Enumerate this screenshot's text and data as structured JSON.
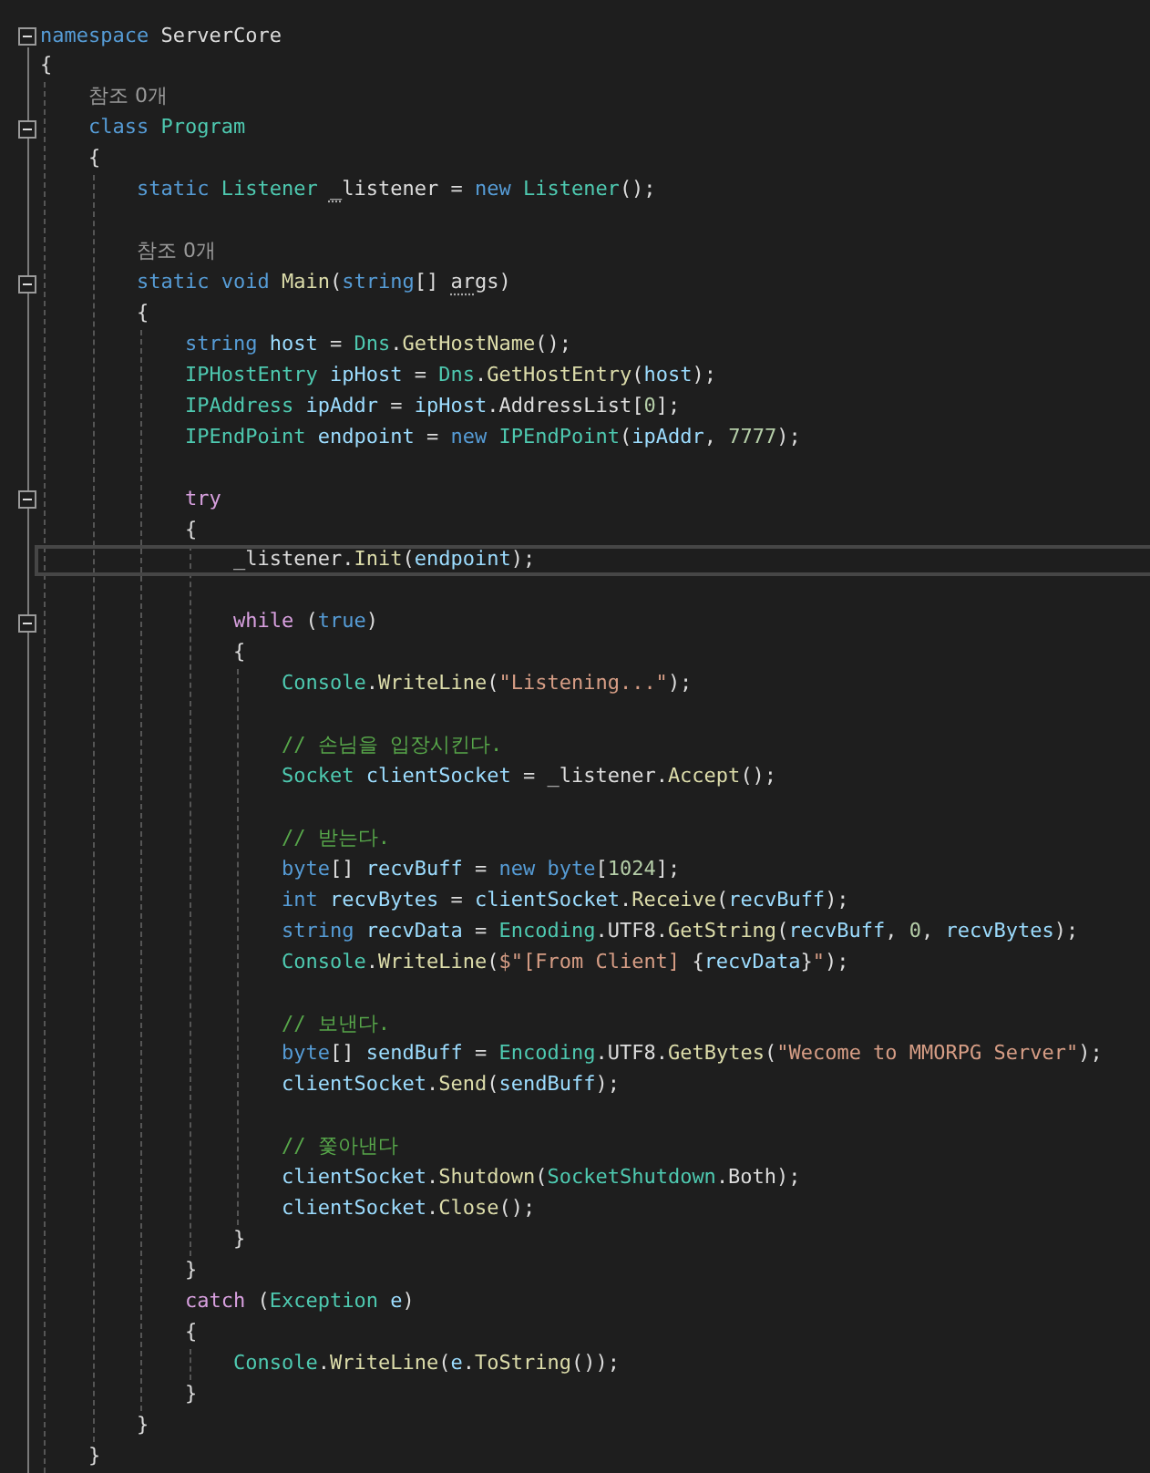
{
  "lines": [
    {
      "kind": "code",
      "fold": {
        "expanded": true
      },
      "tokens": [
        {
          "kind": "keyword",
          "text": "namespace "
        },
        {
          "kind": "plain",
          "text": "ServerCore"
        }
      ]
    },
    {
      "kind": "code",
      "tokens": [
        {
          "kind": "plain",
          "text": "{"
        }
      ],
      "children": [
        {
          "kind": "codelens",
          "text": "참조 0개"
        },
        {
          "kind": "code",
          "fold": {
            "expanded": true
          },
          "tokens": [
            {
              "kind": "keyword",
              "text": "class "
            },
            {
              "kind": "type",
              "text": "Program"
            }
          ]
        },
        {
          "kind": "code",
          "tokens": [
            {
              "kind": "plain",
              "text": "{"
            }
          ],
          "children": [
            {
              "kind": "code",
              "tokens": [
                {
                  "kind": "keyword",
                  "text": "static "
                },
                {
                  "kind": "type",
                  "text": "Listener "
                },
                {
                  "kind": "plain",
                  "text": "_",
                  "underlined": true
                },
                {
                  "kind": "plain",
                  "text": "listener = "
                },
                {
                  "kind": "keyword",
                  "text": "new "
                },
                {
                  "kind": "type",
                  "text": "Listener"
                },
                {
                  "kind": "plain",
                  "text": "();"
                }
              ]
            },
            {
              "kind": "blank"
            },
            {
              "kind": "codelens",
              "text": "참조 0개"
            },
            {
              "kind": "code",
              "fold": {
                "expanded": true
              },
              "tokens": [
                {
                  "kind": "keyword",
                  "text": "static "
                },
                {
                  "kind": "keyword",
                  "text": "void "
                },
                {
                  "kind": "method",
                  "text": "Main"
                },
                {
                  "kind": "plain",
                  "text": "("
                },
                {
                  "kind": "keyword",
                  "text": "string"
                },
                {
                  "kind": "plain",
                  "text": "[] "
                },
                {
                  "kind": "plain",
                  "text": "ar",
                  "underlined": true
                },
                {
                  "kind": "plain",
                  "text": "gs)"
                }
              ]
            },
            {
              "kind": "code",
              "tokens": [
                {
                  "kind": "plain",
                  "text": "{"
                }
              ],
              "children": [
                {
                  "kind": "code",
                  "tokens": [
                    {
                      "kind": "keyword",
                      "text": "string "
                    },
                    {
                      "kind": "variable",
                      "text": "host"
                    },
                    {
                      "kind": "plain",
                      "text": " = "
                    },
                    {
                      "kind": "type",
                      "text": "Dns"
                    },
                    {
                      "kind": "plain",
                      "text": "."
                    },
                    {
                      "kind": "method",
                      "text": "GetHostName"
                    },
                    {
                      "kind": "plain",
                      "text": "();"
                    }
                  ]
                },
                {
                  "kind": "code",
                  "tokens": [
                    {
                      "kind": "type",
                      "text": "IPHostEntry "
                    },
                    {
                      "kind": "variable",
                      "text": "ipHost"
                    },
                    {
                      "kind": "plain",
                      "text": " = "
                    },
                    {
                      "kind": "type",
                      "text": "Dns"
                    },
                    {
                      "kind": "plain",
                      "text": "."
                    },
                    {
                      "kind": "method",
                      "text": "GetHostEntry"
                    },
                    {
                      "kind": "plain",
                      "text": "("
                    },
                    {
                      "kind": "variable",
                      "text": "host"
                    },
                    {
                      "kind": "plain",
                      "text": ");"
                    }
                  ]
                },
                {
                  "kind": "code",
                  "tokens": [
                    {
                      "kind": "type",
                      "text": "IPAddress "
                    },
                    {
                      "kind": "variable",
                      "text": "ipAddr"
                    },
                    {
                      "kind": "plain",
                      "text": " = "
                    },
                    {
                      "kind": "variable",
                      "text": "ipHost"
                    },
                    {
                      "kind": "plain",
                      "text": ".AddressList["
                    },
                    {
                      "kind": "number",
                      "text": "0"
                    },
                    {
                      "kind": "plain",
                      "text": "];"
                    }
                  ]
                },
                {
                  "kind": "code",
                  "tokens": [
                    {
                      "kind": "type",
                      "text": "IPEndPoint "
                    },
                    {
                      "kind": "variable",
                      "text": "endpoint"
                    },
                    {
                      "kind": "plain",
                      "text": " = "
                    },
                    {
                      "kind": "keyword",
                      "text": "new "
                    },
                    {
                      "kind": "type",
                      "text": "IPEndPoint"
                    },
                    {
                      "kind": "plain",
                      "text": "("
                    },
                    {
                      "kind": "variable",
                      "text": "ipAddr"
                    },
                    {
                      "kind": "plain",
                      "text": ", "
                    },
                    {
                      "kind": "number",
                      "text": "7777"
                    },
                    {
                      "kind": "plain",
                      "text": ");"
                    }
                  ]
                },
                {
                  "kind": "blank"
                },
                {
                  "kind": "code",
                  "fold": {
                    "expanded": true
                  },
                  "tokens": [
                    {
                      "kind": "control",
                      "text": "try"
                    }
                  ]
                },
                {
                  "kind": "code",
                  "tokens": [
                    {
                      "kind": "plain",
                      "text": "{"
                    }
                  ],
                  "children": [
                    {
                      "kind": "code",
                      "current": true,
                      "tokens": [
                        {
                          "kind": "plain",
                          "text": "_listener."
                        },
                        {
                          "kind": "method",
                          "text": "Init"
                        },
                        {
                          "kind": "plain",
                          "text": "("
                        },
                        {
                          "kind": "variable",
                          "text": "endpoint"
                        },
                        {
                          "kind": "plain",
                          "text": ");"
                        }
                      ]
                    },
                    {
                      "kind": "blank"
                    },
                    {
                      "kind": "code",
                      "fold": {
                        "expanded": true
                      },
                      "tokens": [
                        {
                          "kind": "control",
                          "text": "while"
                        },
                        {
                          "kind": "plain",
                          "text": " ("
                        },
                        {
                          "kind": "keyword",
                          "text": "true"
                        },
                        {
                          "kind": "plain",
                          "text": ")"
                        }
                      ]
                    },
                    {
                      "kind": "code",
                      "tokens": [
                        {
                          "kind": "plain",
                          "text": "{"
                        }
                      ],
                      "children": [
                        {
                          "kind": "code",
                          "tokens": [
                            {
                              "kind": "type",
                              "text": "Console"
                            },
                            {
                              "kind": "plain",
                              "text": "."
                            },
                            {
                              "kind": "method",
                              "text": "WriteLine"
                            },
                            {
                              "kind": "plain",
                              "text": "("
                            },
                            {
                              "kind": "string",
                              "text": "\"Listening...\""
                            },
                            {
                              "kind": "plain",
                              "text": ");"
                            }
                          ]
                        },
                        {
                          "kind": "blank"
                        },
                        {
                          "kind": "code",
                          "tokens": [
                            {
                              "kind": "comment",
                              "text": "// 손님을 입장시킨다."
                            }
                          ]
                        },
                        {
                          "kind": "code",
                          "tokens": [
                            {
                              "kind": "type",
                              "text": "Socket "
                            },
                            {
                              "kind": "variable",
                              "text": "clientSocket"
                            },
                            {
                              "kind": "plain",
                              "text": " = _listener."
                            },
                            {
                              "kind": "method",
                              "text": "Accept"
                            },
                            {
                              "kind": "plain",
                              "text": "();"
                            }
                          ]
                        },
                        {
                          "kind": "blank"
                        },
                        {
                          "kind": "code",
                          "tokens": [
                            {
                              "kind": "comment",
                              "text": "// 받는다."
                            }
                          ]
                        },
                        {
                          "kind": "code",
                          "tokens": [
                            {
                              "kind": "keyword",
                              "text": "byte"
                            },
                            {
                              "kind": "plain",
                              "text": "[] "
                            },
                            {
                              "kind": "variable",
                              "text": "recvBuff"
                            },
                            {
                              "kind": "plain",
                              "text": " = "
                            },
                            {
                              "kind": "keyword",
                              "text": "new "
                            },
                            {
                              "kind": "keyword",
                              "text": "byte"
                            },
                            {
                              "kind": "plain",
                              "text": "["
                            },
                            {
                              "kind": "number",
                              "text": "1024"
                            },
                            {
                              "kind": "plain",
                              "text": "];"
                            }
                          ]
                        },
                        {
                          "kind": "code",
                          "tokens": [
                            {
                              "kind": "keyword",
                              "text": "int "
                            },
                            {
                              "kind": "variable",
                              "text": "recvBytes"
                            },
                            {
                              "kind": "plain",
                              "text": " = "
                            },
                            {
                              "kind": "variable",
                              "text": "clientSocket"
                            },
                            {
                              "kind": "plain",
                              "text": "."
                            },
                            {
                              "kind": "method",
                              "text": "Receive"
                            },
                            {
                              "kind": "plain",
                              "text": "("
                            },
                            {
                              "kind": "variable",
                              "text": "recvBuff"
                            },
                            {
                              "kind": "plain",
                              "text": ");"
                            }
                          ]
                        },
                        {
                          "kind": "code",
                          "tokens": [
                            {
                              "kind": "keyword",
                              "text": "string "
                            },
                            {
                              "kind": "variable",
                              "text": "recvData"
                            },
                            {
                              "kind": "plain",
                              "text": " = "
                            },
                            {
                              "kind": "type",
                              "text": "Encoding"
                            },
                            {
                              "kind": "plain",
                              "text": ".UTF8."
                            },
                            {
                              "kind": "method",
                              "text": "GetString"
                            },
                            {
                              "kind": "plain",
                              "text": "("
                            },
                            {
                              "kind": "variable",
                              "text": "recvBuff"
                            },
                            {
                              "kind": "plain",
                              "text": ", "
                            },
                            {
                              "kind": "number",
                              "text": "0"
                            },
                            {
                              "kind": "plain",
                              "text": ", "
                            },
                            {
                              "kind": "variable",
                              "text": "recvBytes"
                            },
                            {
                              "kind": "plain",
                              "text": ");"
                            }
                          ]
                        },
                        {
                          "kind": "code",
                          "tokens": [
                            {
                              "kind": "type",
                              "text": "Console"
                            },
                            {
                              "kind": "plain",
                              "text": "."
                            },
                            {
                              "kind": "method",
                              "text": "WriteLine"
                            },
                            {
                              "kind": "plain",
                              "text": "("
                            },
                            {
                              "kind": "string",
                              "text": "$\"[From Client] "
                            },
                            {
                              "kind": "plain",
                              "text": "{"
                            },
                            {
                              "kind": "variable",
                              "text": "recvData"
                            },
                            {
                              "kind": "plain",
                              "text": "}"
                            },
                            {
                              "kind": "string",
                              "text": "\""
                            },
                            {
                              "kind": "plain",
                              "text": ");"
                            }
                          ]
                        },
                        {
                          "kind": "blank"
                        },
                        {
                          "kind": "code",
                          "tokens": [
                            {
                              "kind": "comment",
                              "text": "// 보낸다."
                            }
                          ]
                        },
                        {
                          "kind": "code",
                          "tokens": [
                            {
                              "kind": "keyword",
                              "text": "byte"
                            },
                            {
                              "kind": "plain",
                              "text": "[] "
                            },
                            {
                              "kind": "variable",
                              "text": "sendBuff"
                            },
                            {
                              "kind": "plain",
                              "text": " = "
                            },
                            {
                              "kind": "type",
                              "text": "Encoding"
                            },
                            {
                              "kind": "plain",
                              "text": ".UTF8."
                            },
                            {
                              "kind": "method",
                              "text": "GetBytes"
                            },
                            {
                              "kind": "plain",
                              "text": "("
                            },
                            {
                              "kind": "string",
                              "text": "\"Wecome to MMORPG Server\""
                            },
                            {
                              "kind": "plain",
                              "text": ");"
                            }
                          ]
                        },
                        {
                          "kind": "code",
                          "tokens": [
                            {
                              "kind": "variable",
                              "text": "clientSocket"
                            },
                            {
                              "kind": "plain",
                              "text": "."
                            },
                            {
                              "kind": "method",
                              "text": "Send"
                            },
                            {
                              "kind": "plain",
                              "text": "("
                            },
                            {
                              "kind": "variable",
                              "text": "sendBuff"
                            },
                            {
                              "kind": "plain",
                              "text": ");"
                            }
                          ]
                        },
                        {
                          "kind": "blank"
                        },
                        {
                          "kind": "code",
                          "tokens": [
                            {
                              "kind": "comment",
                              "text": "// 쫓아낸다"
                            }
                          ]
                        },
                        {
                          "kind": "code",
                          "tokens": [
                            {
                              "kind": "variable",
                              "text": "clientSocket"
                            },
                            {
                              "kind": "plain",
                              "text": "."
                            },
                            {
                              "kind": "method",
                              "text": "Shutdown"
                            },
                            {
                              "kind": "plain",
                              "text": "("
                            },
                            {
                              "kind": "type",
                              "text": "SocketShutdown"
                            },
                            {
                              "kind": "plain",
                              "text": ".Both);"
                            }
                          ]
                        },
                        {
                          "kind": "code",
                          "tokens": [
                            {
                              "kind": "variable",
                              "text": "clientSocket"
                            },
                            {
                              "kind": "plain",
                              "text": "."
                            },
                            {
                              "kind": "method",
                              "text": "Close"
                            },
                            {
                              "kind": "plain",
                              "text": "();"
                            }
                          ]
                        }
                      ]
                    },
                    {
                      "kind": "code",
                      "tokens": [
                        {
                          "kind": "plain",
                          "text": "}"
                        }
                      ]
                    }
                  ]
                },
                {
                  "kind": "code",
                  "tokens": [
                    {
                      "kind": "plain",
                      "text": "}"
                    }
                  ]
                },
                {
                  "kind": "code",
                  "tokens": [
                    {
                      "kind": "control",
                      "text": "catch"
                    },
                    {
                      "kind": "plain",
                      "text": " ("
                    },
                    {
                      "kind": "type",
                      "text": "Exception "
                    },
                    {
                      "kind": "variable",
                      "text": "e"
                    },
                    {
                      "kind": "plain",
                      "text": ")"
                    }
                  ]
                },
                {
                  "kind": "code",
                  "tokens": [
                    {
                      "kind": "plain",
                      "text": "{"
                    }
                  ],
                  "children": [
                    {
                      "kind": "code",
                      "tokens": [
                        {
                          "kind": "type",
                          "text": "Console"
                        },
                        {
                          "kind": "plain",
                          "text": "."
                        },
                        {
                          "kind": "method",
                          "text": "WriteLine"
                        },
                        {
                          "kind": "plain",
                          "text": "("
                        },
                        {
                          "kind": "variable",
                          "text": "e"
                        },
                        {
                          "kind": "plain",
                          "text": "."
                        },
                        {
                          "kind": "method",
                          "text": "ToString"
                        },
                        {
                          "kind": "plain",
                          "text": "());"
                        }
                      ]
                    }
                  ]
                },
                {
                  "kind": "code",
                  "tokens": [
                    {
                      "kind": "plain",
                      "text": "}"
                    }
                  ]
                }
              ]
            },
            {
              "kind": "code",
              "tokens": [
                {
                  "kind": "plain",
                  "text": "}"
                }
              ]
            }
          ]
        },
        {
          "kind": "code",
          "tokens": [
            {
              "kind": "plain",
              "text": "}"
            }
          ]
        }
      ]
    }
  ]
}
